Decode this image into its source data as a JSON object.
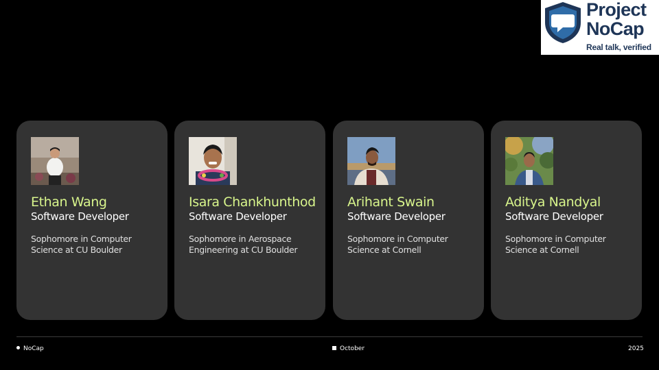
{
  "logo": {
    "title": "Project NoCap",
    "tagline": "Real talk, verified",
    "icon": "shield-speech-bubble-icon",
    "colors": {
      "navy": "#1e3557",
      "shield_blue": "#2f6ca8"
    }
  },
  "team": [
    {
      "name": "Ethan Wang",
      "role": "Software Developer",
      "description": "Sophomore in Computer Science at CU Boulder",
      "photo": "portrait-photo"
    },
    {
      "name": "Isara Chankhunthod",
      "role": "Software Developer",
      "description": "Sophomore in Aerospace Engineering at CU Boulder",
      "photo": "portrait-photo"
    },
    {
      "name": "Arihant Swain",
      "role": "Software Developer",
      "description": "Sophomore in Computer Science at Cornell",
      "photo": "portrait-photo"
    },
    {
      "name": "Aditya Nandyal",
      "role": "Software Developer",
      "description": "Sophomore in Computer Science at Cornell",
      "photo": "portrait-photo"
    }
  ],
  "footer": {
    "left": "NoCap",
    "center": "October",
    "right": "2025"
  },
  "colors": {
    "background": "#000000",
    "card": "#333333",
    "name_accent": "#d8f58c"
  }
}
